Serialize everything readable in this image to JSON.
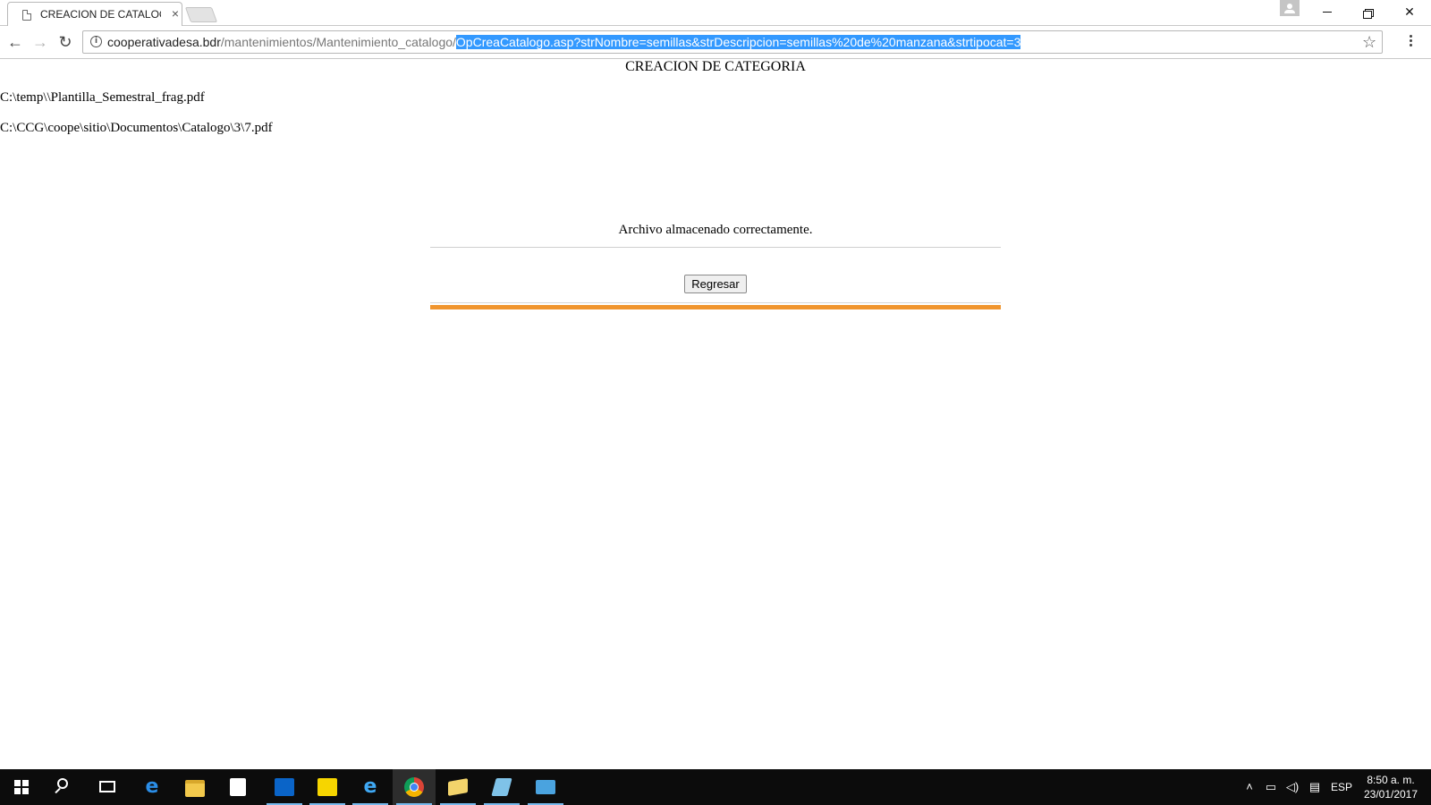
{
  "browser": {
    "tab_title": "CREACION DE CATALOGO",
    "tab_close": "×",
    "url_host": "cooperativadesa.bdr",
    "url_path": "/mantenimientos/Mantenimiento_catalogo/",
    "url_selected": "OpCreaCatalogo.asp?strNombre=semillas&strDescripcion=semillas%20de%20manzana&strtipocat=3",
    "icons": {
      "back": "←",
      "forward": "→",
      "reload": "↻",
      "info": "i",
      "star": "☆",
      "minimize": "minimize-icon",
      "maximize": "restore-icon",
      "close": "✕"
    }
  },
  "page": {
    "title": "CREACION DE CATEGORIA",
    "paths": [
      "C:\\temp\\\\Plantilla_Semestral_frag.pdf",
      "C:\\CCG\\coope\\sitio\\Documentos\\Catalogo\\3\\7.pdf"
    ],
    "message": "Archivo almacenado correctamente.",
    "back_button": "Regresar",
    "accent_color": "#f0952e"
  },
  "taskbar": {
    "apps": [
      "start",
      "search",
      "task-view",
      "edge",
      "file-explorer",
      "store",
      "outlook",
      "app-yellow",
      "internet-explorer",
      "chrome",
      "app-folder",
      "app-notepad",
      "app-control-panel"
    ],
    "language": "ESP",
    "time": "8:50 a. m.",
    "date": "23/01/2017"
  }
}
